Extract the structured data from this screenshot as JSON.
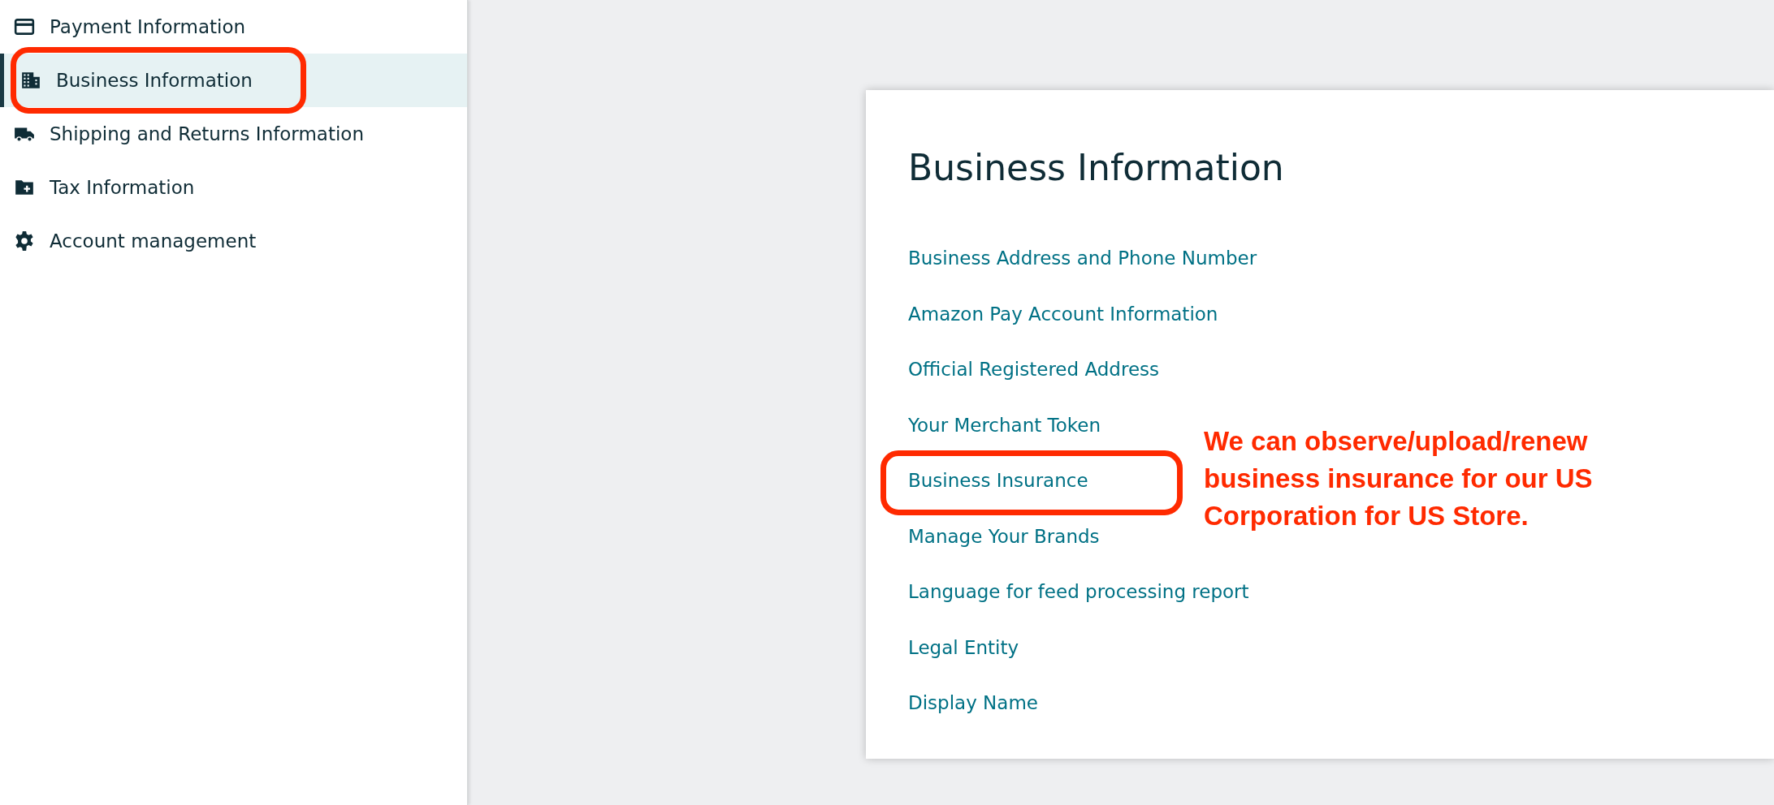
{
  "sidebar": {
    "items": [
      {
        "label": "Payment Information",
        "selected": false,
        "circled": false
      },
      {
        "label": "Business Information",
        "selected": true,
        "circled": true
      },
      {
        "label": "Shipping and Returns Information",
        "selected": false,
        "circled": false
      },
      {
        "label": "Tax Information",
        "selected": false,
        "circled": false
      },
      {
        "label": "Account management",
        "selected": false,
        "circled": false
      }
    ]
  },
  "card": {
    "title": "Business Information",
    "links": [
      {
        "label": "Business Address and Phone Number",
        "circled": false
      },
      {
        "label": "Amazon Pay Account Information",
        "circled": false
      },
      {
        "label": "Official Registered Address",
        "circled": false
      },
      {
        "label": "Your Merchant Token",
        "circled": false
      },
      {
        "label": "Business Insurance",
        "circled": true
      },
      {
        "label": "Manage Your Brands",
        "circled": false
      },
      {
        "label": "Language for feed processing report",
        "circled": false
      },
      {
        "label": "Legal Entity",
        "circled": false
      },
      {
        "label": "Display Name",
        "circled": false
      }
    ],
    "note": "We can observe/upload/renew business insurance for our US Corporation for US Store."
  }
}
